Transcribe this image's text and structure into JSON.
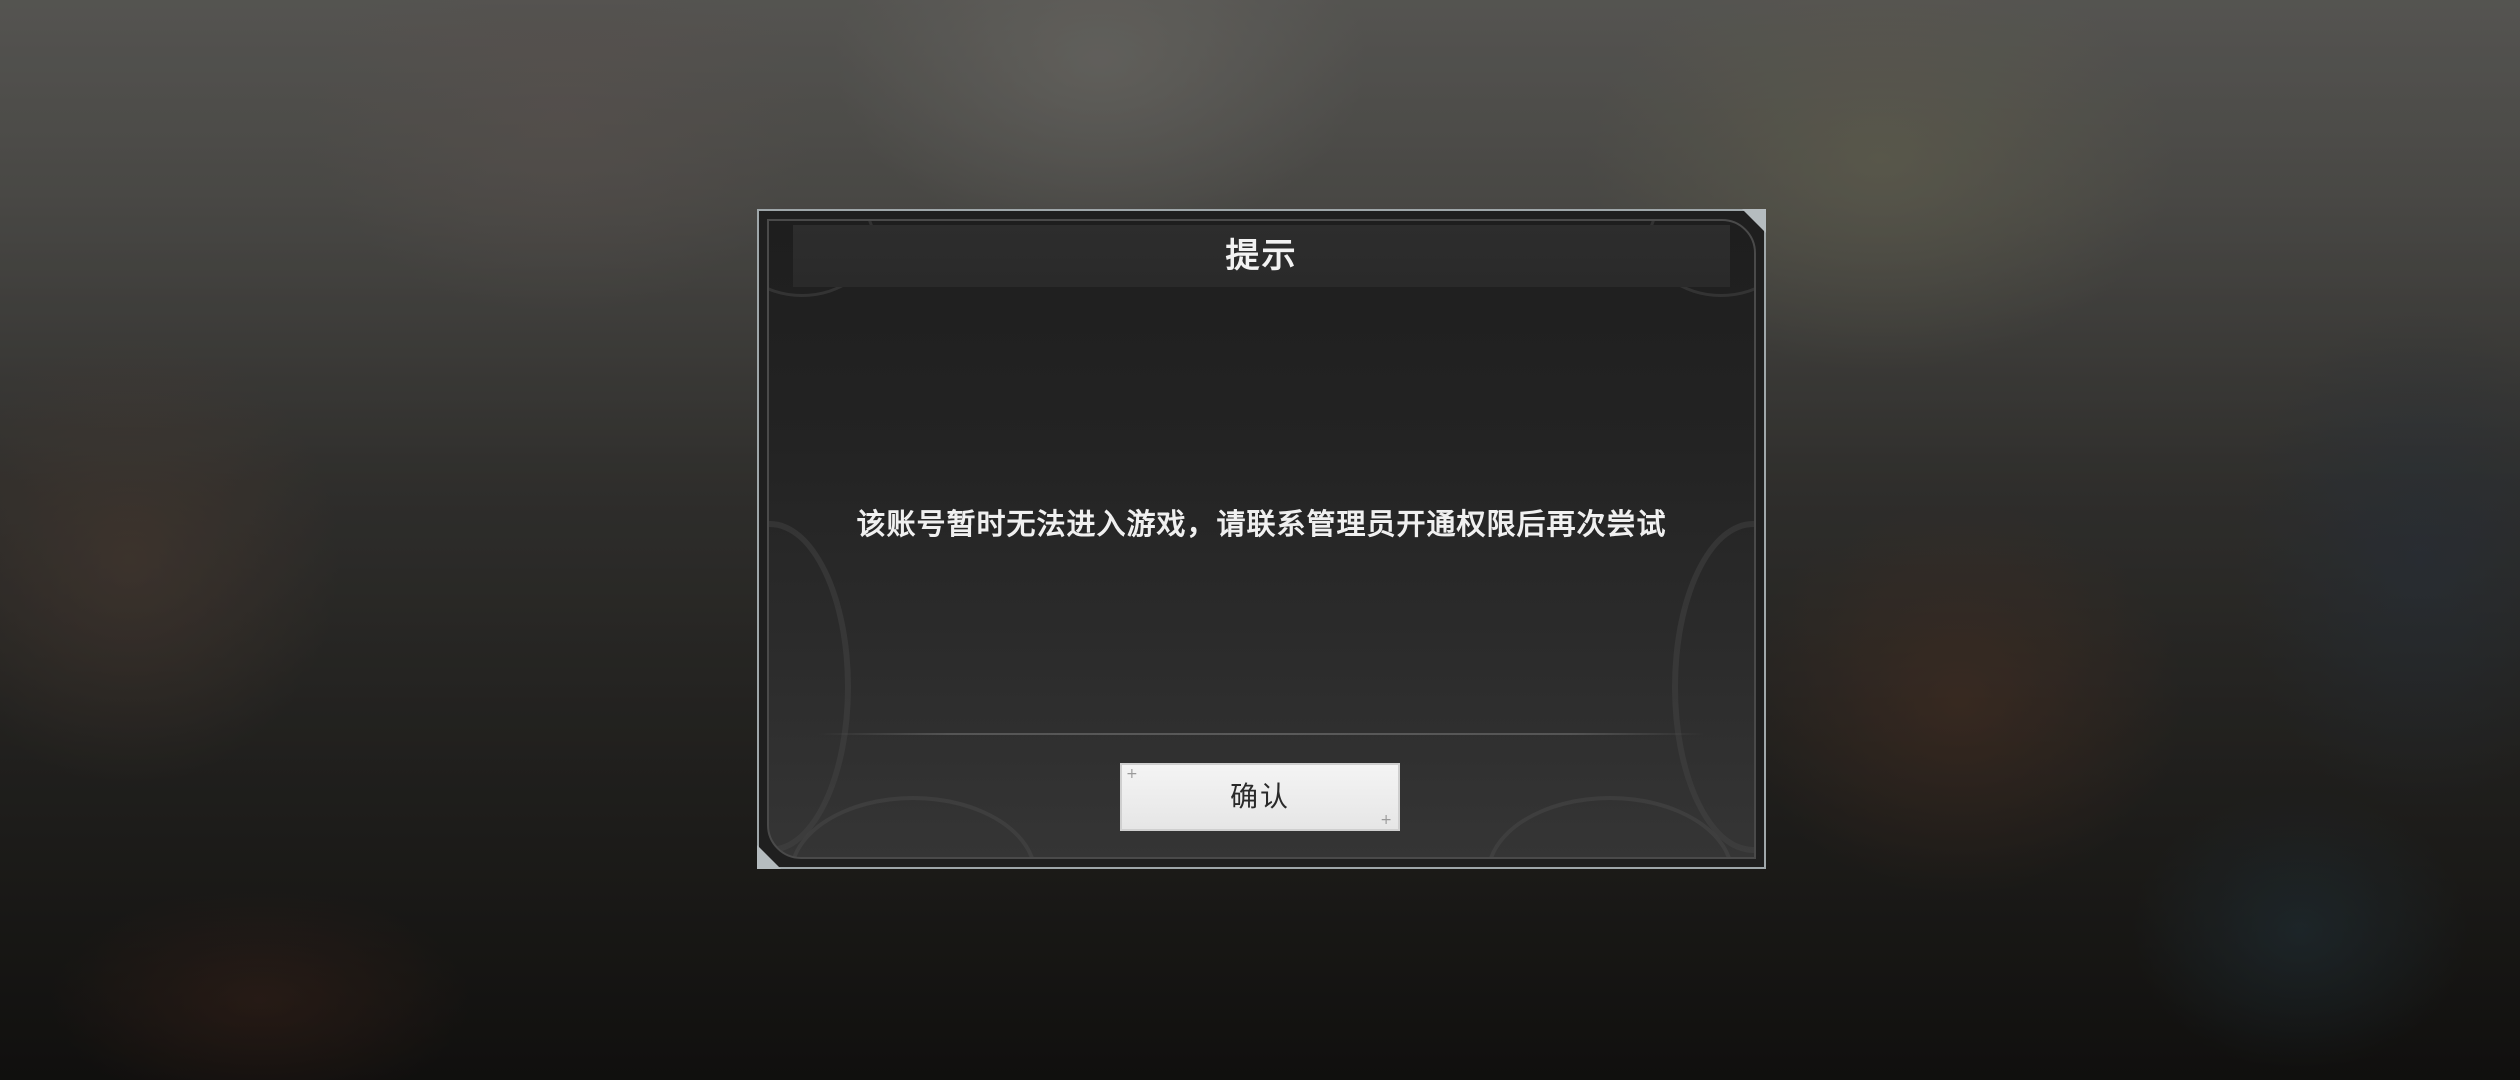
{
  "dialog": {
    "title": "提示",
    "message": "该账号暂时无法进入游戏，请联系管理员开通权限后再次尝试",
    "confirm_label": "确认"
  },
  "icons": {
    "button_corner_mark": "+"
  },
  "colors": {
    "dialog_border": "#9fa7aa",
    "dialog_background": "#232323",
    "button_background": "#eeeeee",
    "text": "#f0f0f0"
  }
}
